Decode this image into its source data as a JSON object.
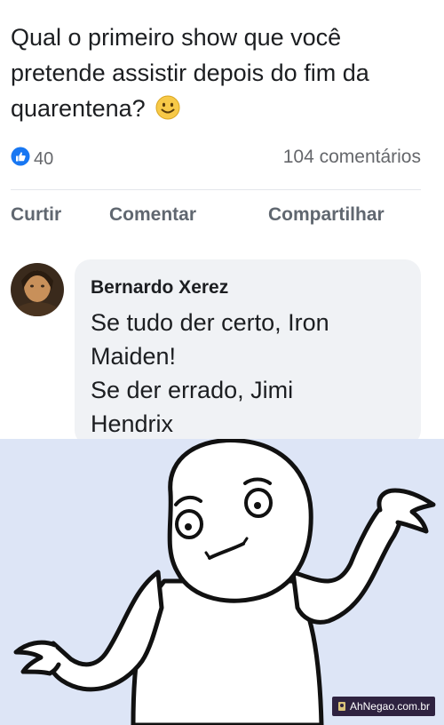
{
  "post": {
    "question": "Qual o primeiro show que você pretende assistir depois do fim da quarentena?",
    "emoji": "smiley-emoji",
    "like_count": "40",
    "comment_count": "104 comentários",
    "actions": {
      "like": "Curtir",
      "comment": "Comentar",
      "share": "Compartilhar"
    }
  },
  "comment": {
    "author": "Bernardo Xerez",
    "lines": [
      "Se tudo der certo, Iron",
      "Maiden!",
      "Se der errado, Jimi",
      "Hendrix"
    ]
  },
  "meme": {
    "icon": "shrug-meme-character"
  },
  "watermark": {
    "text": "AhNegao.com.br"
  },
  "colors": {
    "like_blue": "#1877f2",
    "meme_bg": "#dde5f6",
    "watermark_bg": "#2e2240"
  }
}
